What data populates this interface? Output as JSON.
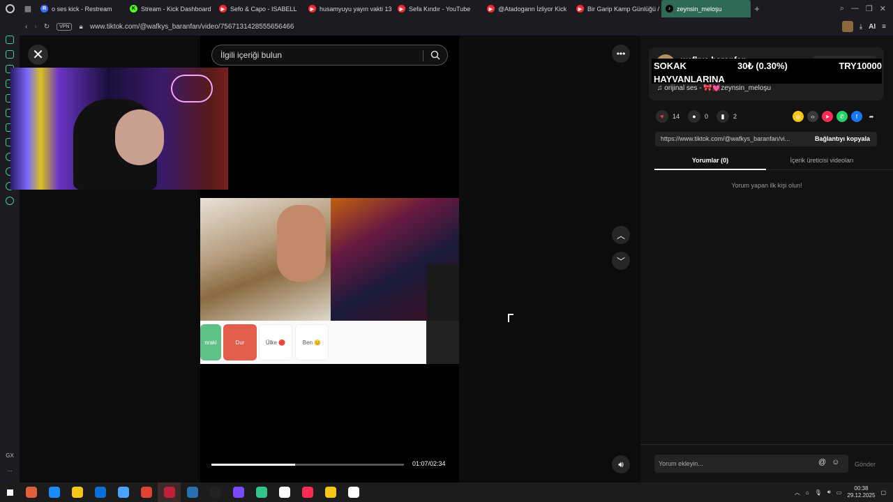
{
  "browser": {
    "tabs": [
      {
        "label": "o ses kick - Restream",
        "color": "#3a6cff",
        "glyph": "R"
      },
      {
        "label": "Stream - Kick Dashboard",
        "color": "#53fc18",
        "glyph": "K"
      },
      {
        "label": "Sefo & Capo - ISABELL",
        "color": "#ff2a2a",
        "glyph": "▶"
      },
      {
        "label": "husamyuyu yayın vakti 13",
        "color": "#ff2a2a",
        "glyph": "▶"
      },
      {
        "label": "Sefa Kındır - YouTube",
        "color": "#ff2a2a",
        "glyph": "▶"
      },
      {
        "label": "@Atadogann İzliyor Kick",
        "color": "#ff2a2a",
        "glyph": "▶"
      },
      {
        "label": "Bir Garip Kamp Günlüğü /",
        "color": "#ff2a2a",
        "glyph": "▶"
      },
      {
        "label": "zeynsin_meloşu",
        "color": "#000000",
        "glyph": "♪",
        "active": true
      }
    ],
    "url": "www.tiktok.com/@wafkys_baranfan/video/7567131428555656466",
    "vpn_label": "VPN",
    "ai_label": "AI"
  },
  "video": {
    "search_placeholder": "İlgili içeriği bulun",
    "time": "01:07/02:34",
    "progress": 0.434,
    "buttons": {
      "onraki": "nraki",
      "dur": "Dur",
      "ulke": "Ülke 🔴",
      "ben": "Ben 😊"
    }
  },
  "panel": {
    "author": "wafkys baranfan",
    "overlay": {
      "line1": "SOKAK",
      "line2": "HAYVANLARINA",
      "middle": "30₺ (0.30%)",
      "right": "TRY10000"
    },
    "music": "♫  orijinal ses - 🎀💓zeynsin_meloşu",
    "likes": "14",
    "comments": "0",
    "saves": "2",
    "link": "https://www.tiktok.com/@wafkys_baranfan/vi...",
    "copy_label": "Bağlantıyı kopyala",
    "tab_comments": "Yorumlar (0)",
    "tab_creator": "İçerik üreticisi videoları",
    "empty_message": "Yorum yapan ilk kişi olun!",
    "comment_placeholder": "Yorum ekleyin...",
    "send_label": "Gönder",
    "share_colors": [
      "#f5c518",
      "#3a3a3a",
      "#fe2c55",
      "#25d366",
      "#1877f2",
      "#3a3a3a"
    ]
  },
  "sidebar": {
    "bottom_label": "GX",
    "more_label": "..."
  },
  "taskbar": {
    "time": "00:38",
    "date": "29.12.2025",
    "icons": [
      "#e0603a",
      "#1a8cff",
      "#f5c518",
      "#0a6fd6",
      "#4aa3ff",
      "#dd4433",
      "#c0203a",
      "#2a6fb0",
      "#222222",
      "#7a4aff",
      "#31c48d",
      "#ffffff",
      "#fe2c55",
      "#f5c518",
      "#ffffff"
    ]
  }
}
